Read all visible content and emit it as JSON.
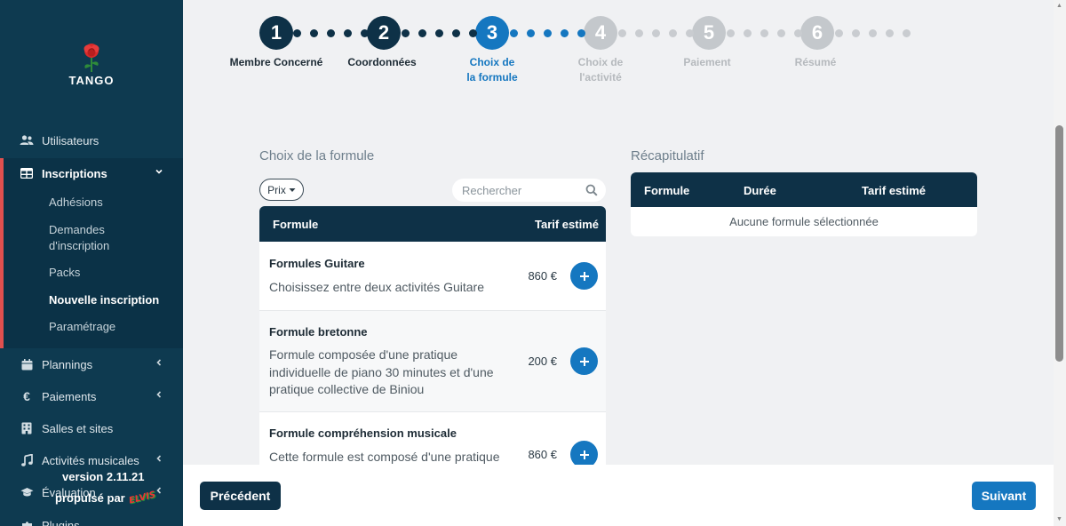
{
  "app": {
    "logo_text": "TANGO",
    "version": "version 2.11.21",
    "powered_by": "propulsé par",
    "powered_brand": "ELVIS"
  },
  "sidebar": {
    "utilisateurs": "Utilisateurs",
    "inscriptions": "Inscriptions",
    "sub_items": [
      "Adhésions",
      "Demandes d'inscription",
      "Packs",
      "Nouvelle inscription",
      "Paramétrage"
    ],
    "plannings": "Plannings",
    "paiements": "Paiements",
    "salles": "Salles et sites",
    "activites": "Activités musicales",
    "evaluation": "Évaluation",
    "plugins": "Plugins"
  },
  "stepper": {
    "current_step": 3,
    "steps": [
      {
        "number": "1",
        "label": "Membre Concerné",
        "state": "done"
      },
      {
        "number": "2",
        "label": "Coordonnées",
        "state": "done"
      },
      {
        "number": "3",
        "label": "Choix de la formule",
        "state": "current"
      },
      {
        "number": "4",
        "label": "Choix de l'activité",
        "state": "todo"
      },
      {
        "number": "5",
        "label": "Paiement",
        "state": "todo"
      },
      {
        "number": "6",
        "label": "Résumé",
        "state": "todo"
      }
    ]
  },
  "formules": {
    "title": "Choix de la formule",
    "filter_label": "Prix",
    "search_placeholder": "Rechercher",
    "col_formule": "Formule",
    "col_tarif": "Tarif estimé",
    "rows": [
      {
        "name": "Formules Guitare",
        "description": "Choisissez entre deux activités Guitare",
        "price": "860 €"
      },
      {
        "name": "Formule bretonne",
        "description": "Formule composée d'une pratique individuelle de piano 30 minutes et d'une pratique collective de Biniou",
        "price": "200 €"
      },
      {
        "name": "Formule compréhension musicale",
        "description": "Cette formule est composé d'une pratique",
        "price": "860 €"
      }
    ]
  },
  "recap": {
    "title": "Récapitulatif",
    "col_formule": "Formule",
    "col_duree": "Durée",
    "col_tarif": "Tarif estimé",
    "empty_text": "Aucune formule sélectionnée"
  },
  "footer": {
    "prev_label": "Précédent",
    "next_label": "Suivant"
  },
  "colors": {
    "sidebar_bg": "#0e3a50",
    "primary_dark": "#0e3147",
    "accent_blue": "#1577c0",
    "active_marker": "#e0504f"
  }
}
